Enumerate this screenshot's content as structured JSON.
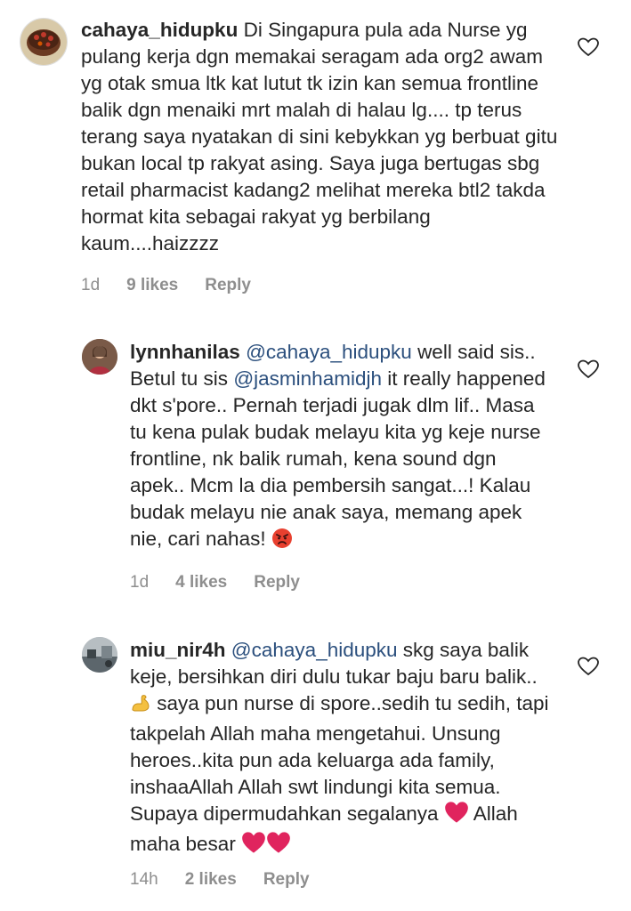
{
  "comments": [
    {
      "username": "cahaya_hidupku",
      "text": "Di Singapura pula ada Nurse yg pulang kerja dgn memakai seragam ada org2 awam yg otak smua ltk kat lutut tk izin kan semua frontline balik dgn menaiki mrt malah di halau lg.... tp terus terang saya nyatakan di sini kebykkan yg berbuat gitu bukan local tp rakyat asing. Saya juga bertugas sbg retail pharmacist kadang2 melihat mereka btl2 takda hormat kita sebagai rakyat yg berbilang kaum....haizzzz",
      "time": "1d",
      "likes": "9 likes",
      "reply": "Reply"
    },
    {
      "username": "lynnhanilas",
      "mention1": "@cahaya_hidupku",
      "text_a": "well said sis.. Betul tu sis",
      "mention2": "@jasminhamidjh",
      "text_b": "it really happened dkt s'pore.. Pernah terjadi jugak dlm lif.. Masa tu kena pulak budak melayu kita yg keje nurse frontline, nk balik rumah, kena sound dgn apek.. Mcm la dia pembersih sangat...! Kalau budak melayu nie anak saya, memang apek nie, cari nahas!",
      "emoji": "angry-face",
      "time": "1d",
      "likes": "4 likes",
      "reply": "Reply"
    },
    {
      "username": "miu_nir4h",
      "mention1": "@cahaya_hidupku",
      "text_a": "skg saya balik keje, bersihkan diri dulu tukar baju baru balik..",
      "text_b": "saya pun nurse di spore..sedih tu sedih, tapi takpelah Allah maha mengetahui. Unsung heroes..kita pun ada keluarga ada family, inshaaAllah Allah swt lindungi kita semua. Supaya dipermudahkan segalanya",
      "text_c": "Allah maha besar",
      "time": "14h",
      "likes": "2 likes",
      "reply": "Reply"
    }
  ],
  "colors": {
    "text": "#262626",
    "mention": "#2b4f7d",
    "meta": "#8e8e8e",
    "heart_emoji": "#e0245e"
  }
}
